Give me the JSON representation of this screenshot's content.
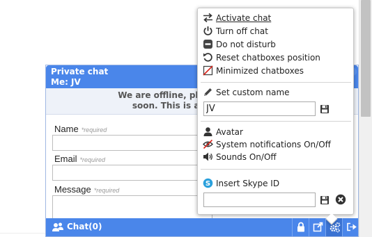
{
  "chat": {
    "title": "Private chat",
    "me_label": "Me: JV",
    "offline_line1": "We are offline, please send us a",
    "offline_line2": "soon. This is a demo form",
    "fields": [
      {
        "label": "Name",
        "required": "*required"
      },
      {
        "label": "Email",
        "required": "*required"
      },
      {
        "label": "Message",
        "required": "*required"
      }
    ],
    "footer_label": "Chat(0)"
  },
  "menu": {
    "items": [
      {
        "label": "Activate chat",
        "icon": "arrows-swap-icon"
      },
      {
        "label": "Turn off chat",
        "icon": "power-icon"
      },
      {
        "label": "Do not disturb",
        "icon": "minus-circle-icon"
      },
      {
        "label": "Reset chatboxes position",
        "icon": "reset-icon"
      },
      {
        "label": "Minimized chatboxes",
        "icon": "minimize-off-icon"
      }
    ],
    "custom_name_label": "Set custom name",
    "custom_name_value": "JV",
    "options": [
      {
        "label": "Avatar",
        "icon": "user-icon"
      },
      {
        "label": "System notifications On/Off",
        "icon": "eye-off-icon"
      },
      {
        "label": "Sounds On/Off",
        "icon": "speaker-icon"
      }
    ],
    "skype_label": "Insert Skype ID",
    "skype_value": ""
  },
  "colors": {
    "accent": "#4a86ea",
    "offline_bg": "#eef2f9"
  }
}
